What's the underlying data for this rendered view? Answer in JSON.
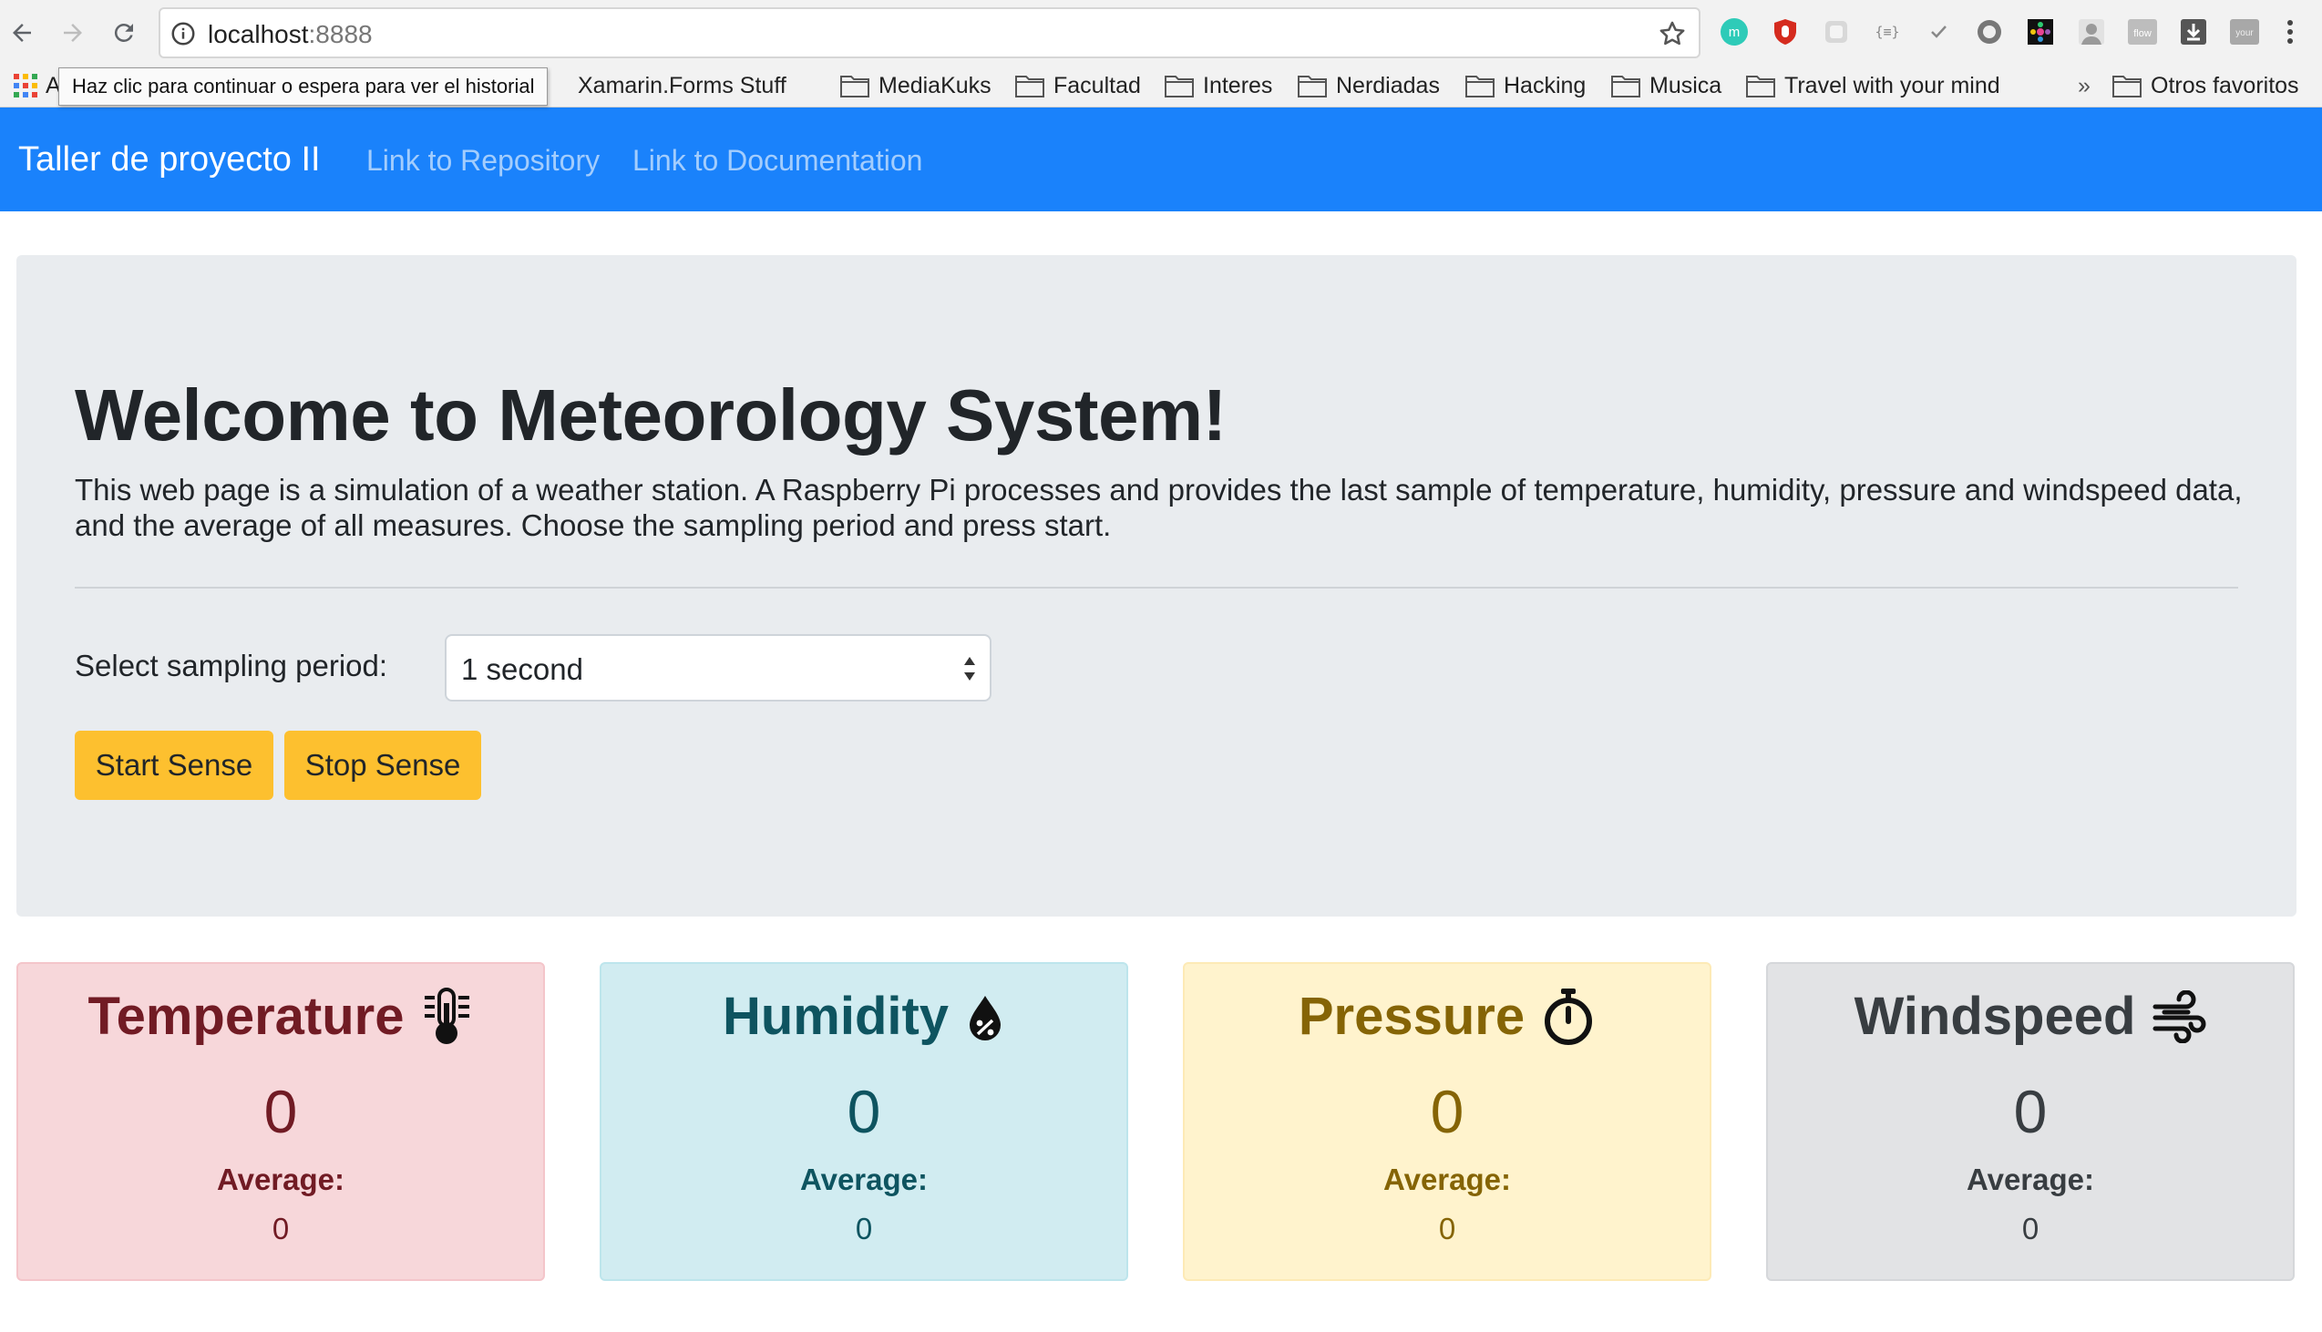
{
  "browser": {
    "url_host": "localhost",
    "url_port": ":8888",
    "tooltip": "Haz clic para continuar o espera para ver el historial",
    "bookmark_apps_letter": "A",
    "bookmarks": [
      {
        "label": "Xamarin.Forms Stuff",
        "folder": false
      },
      {
        "label": "MediaKuks",
        "folder": true
      },
      {
        "label": "Facultad",
        "folder": true
      },
      {
        "label": "Interes",
        "folder": true
      },
      {
        "label": "Nerdiadas",
        "folder": true
      },
      {
        "label": "Hacking",
        "folder": true
      },
      {
        "label": "Musica",
        "folder": true
      },
      {
        "label": "Travel with your mind",
        "folder": true
      }
    ],
    "more_bookmarks": "»",
    "other_bookmarks": "Otros favoritos",
    "extensions": [
      "mercury-icon",
      "ublock-icon",
      "extension-icon",
      "json-formatter-icon",
      "checkmark-icon",
      "circle-extension-icon",
      "color-picker-icon",
      "profile-extension-icon",
      "flow-extension-icon",
      "download-extension-icon",
      "your-extension-icon"
    ],
    "ext_flow_text": "flow",
    "ext_your_text": "your"
  },
  "navbar": {
    "brand": "Taller de proyecto II",
    "links": [
      "Link to Repository",
      "Link to Documentation"
    ],
    "bg_color": "#1a82fb"
  },
  "jumbotron": {
    "title": "Welcome to Meteorology System!",
    "lead": "This web page is a simulation of a weather station. A Raspberry Pi processes and provides the last sample of temperature, humidity, pressure and windspeed data, and the average of all measures. Choose the sampling period and press start.",
    "period_label": "Select sampling period:",
    "period_selected": "1 second",
    "start_button": "Start Sense",
    "stop_button": "Stop Sense"
  },
  "cards": [
    {
      "title": "Temperature",
      "icon": "thermometer-icon",
      "value": "0",
      "avg_label": "Average:",
      "avg_value": "0"
    },
    {
      "title": "Humidity",
      "icon": "humidity-drop-icon",
      "value": "0",
      "avg_label": "Average:",
      "avg_value": "0"
    },
    {
      "title": "Pressure",
      "icon": "stopwatch-icon",
      "value": "0",
      "avg_label": "Average:",
      "avg_value": "0"
    },
    {
      "title": "Windspeed",
      "icon": "wind-icon",
      "value": "0",
      "avg_label": "Average:",
      "avg_value": "0"
    }
  ],
  "colors": {
    "button": "#fdc02f",
    "jumbotron": "#e9ecef",
    "temperature": "#f7d7da",
    "humidity": "#d1ecf1",
    "pressure": "#fff3cd",
    "windspeed": "#e2e3e5"
  }
}
